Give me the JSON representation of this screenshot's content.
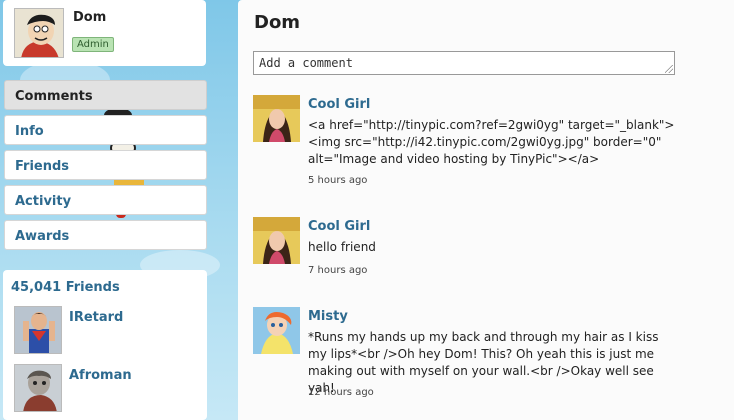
{
  "profile": {
    "name": "Dom",
    "badge": "Admin"
  },
  "nav": [
    {
      "label": "Comments",
      "active": true
    },
    {
      "label": "Info"
    },
    {
      "label": "Friends"
    },
    {
      "label": "Activity"
    },
    {
      "label": "Awards"
    }
  ],
  "friends": {
    "title": "45,041 Friends",
    "items": [
      {
        "name": "IRetard"
      },
      {
        "name": "Afroman"
      }
    ]
  },
  "main": {
    "title": "Dom",
    "comment_placeholder": "Add a comment",
    "comments": [
      {
        "author": "Cool Girl",
        "text": "<a href=\"http://tinypic.com?ref=2gwi0yg\" target=\"_blank\"><img src=\"http://i42.tinypic.com/2gwi0yg.jpg\" border=\"0\" alt=\"Image and video hosting by TinyPic\"></a>",
        "time": "5 hours ago"
      },
      {
        "author": "Cool Girl",
        "text": "hello friend",
        "time": "7 hours ago"
      },
      {
        "author": "Misty",
        "text": "*Runs my hands up my back and through my hair as I kiss my lips*<br />Oh hey Dom! This? Oh yeah this is just me making out with myself on your wall.<br />Okay well see yah!",
        "time": "12 hours ago"
      }
    ]
  }
}
